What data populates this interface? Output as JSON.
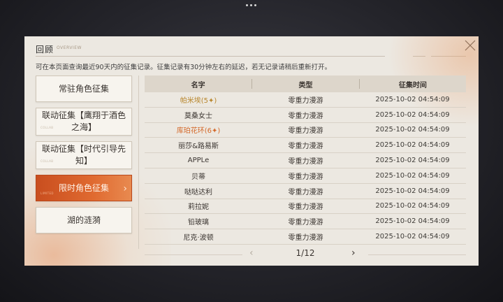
{
  "panel": {
    "title": "回顾",
    "title_deco": "OVERVIEW",
    "notice": "可在本页面查询最近90天内的征集记录。征集记录有30分钟左右的延迟，若无记录请稍后重新打开。"
  },
  "tabs": [
    {
      "label": "常驻角色征集",
      "sub": "",
      "active": false
    },
    {
      "label": "联动征集【鹰翔于酒色之海】",
      "sub": "COLLAB",
      "active": false
    },
    {
      "label": "联动征集【时代引导先知】",
      "sub": "COLLAB",
      "active": false
    },
    {
      "label": "限时角色征集",
      "sub": "LIMITED",
      "active": true
    },
    {
      "label": "湖的涟漪",
      "sub": "",
      "active": false
    }
  ],
  "table": {
    "headers": [
      "名字",
      "类型",
      "征集时间"
    ],
    "rows": [
      {
        "name": "帕米埃(5✦)",
        "type": "零重力漫游",
        "time": "2025-10-02 04:54:09",
        "rarity": "gold"
      },
      {
        "name": "莫桑女士",
        "type": "零重力漫游",
        "time": "2025-10-02 04:54:09",
        "rarity": ""
      },
      {
        "name": "库珀花环(6✦)",
        "type": "零重力漫游",
        "time": "2025-10-02 04:54:09",
        "rarity": "orange"
      },
      {
        "name": "丽莎&路易斯",
        "type": "零重力漫游",
        "time": "2025-10-02 04:54:09",
        "rarity": ""
      },
      {
        "name": "APPLe",
        "type": "零重力漫游",
        "time": "2025-10-02 04:54:09",
        "rarity": ""
      },
      {
        "name": "贝蒂",
        "type": "零重力漫游",
        "time": "2025-10-02 04:54:09",
        "rarity": ""
      },
      {
        "name": "哒哒达利",
        "type": "零重力漫游",
        "time": "2025-10-02 04:54:09",
        "rarity": ""
      },
      {
        "name": "莉拉妮",
        "type": "零重力漫游",
        "time": "2025-10-02 04:54:09",
        "rarity": ""
      },
      {
        "name": "铅玻璃",
        "type": "零重力漫游",
        "time": "2025-10-02 04:54:09",
        "rarity": ""
      },
      {
        "name": "尼克·波顿",
        "type": "零重力漫游",
        "time": "2025-10-02 04:54:09",
        "rarity": ""
      }
    ]
  },
  "pager": {
    "text": "1/12",
    "prev": "‹",
    "next": "›"
  },
  "colors": {
    "accent": "#d9602a",
    "gold": "#b8862c",
    "orange": "#d4692a",
    "panel": "#ece8e1"
  },
  "icons": {
    "close": "close-icon",
    "prev": "chevron-left-icon",
    "next": "chevron-right-icon",
    "tab_arrow": "chevron-right-icon"
  }
}
